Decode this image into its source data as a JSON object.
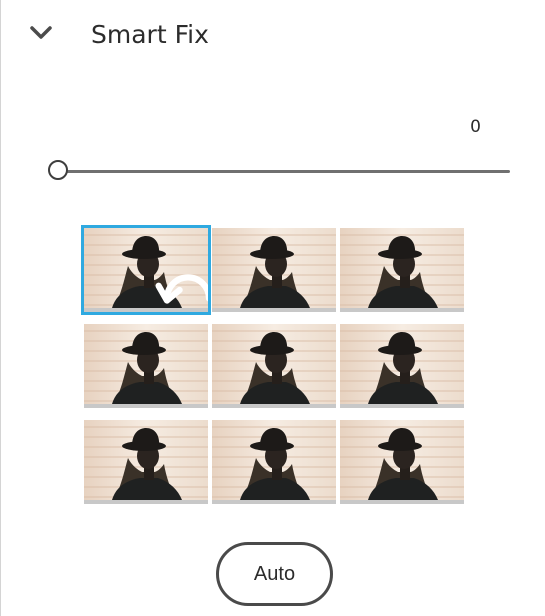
{
  "panel": {
    "title": "Smart Fix",
    "collapse_icon": "chevron-down-icon"
  },
  "slider": {
    "value": "0",
    "fraction": 0
  },
  "thumbnails": {
    "rows": 3,
    "columns": 3,
    "selected_index": 0,
    "selected_overlay_icon": "reset-icon",
    "selection_color": "#2fa9e0"
  },
  "auto_button": {
    "label": "Auto"
  }
}
